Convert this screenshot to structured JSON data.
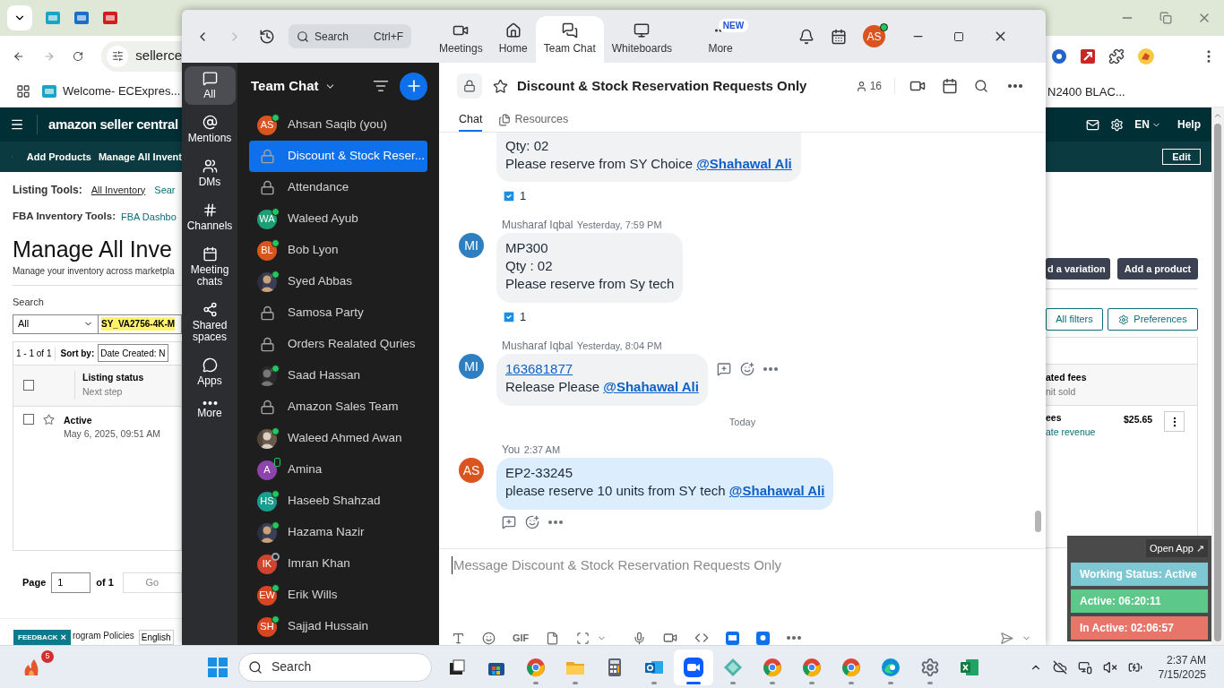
{
  "browser": {
    "address_text": "sellerce",
    "bookmark_left": "Welcome- ECExpres...",
    "bookmark_right": "N2400 BLAC...",
    "logo": "amazon seller central",
    "language": "EN",
    "help": "Help",
    "subnav": [
      "Add Products",
      "Manage All Invent"
    ],
    "edit_button": "Edit",
    "listing_tools": {
      "label": "Listing Tools:",
      "links": [
        "All Inventory",
        "Sear"
      ]
    },
    "fba_tools": {
      "label": "FBA Inventory Tools:",
      "links": [
        "FBA Dashbo"
      ]
    },
    "heading": "Manage All Inve",
    "subheading": "Manage your inventory across marketpla",
    "search_label": "Search",
    "search_scope": "All",
    "search_value": "SY_VA2756-4K-M",
    "result_count": "1 - 1 of 1",
    "sort_label": "Sort by:",
    "sort_value": "Date Created: N",
    "buttons_right": [
      "d a variation",
      "Add a product"
    ],
    "filters_button": "All filters",
    "preferences_button": "Preferences",
    "table": {
      "all_checked": false,
      "columns": [
        {
          "title": "Listing status",
          "subtitle": "Next step"
        },
        {
          "title": "ated fees",
          "subtitle": "nit sold"
        }
      ],
      "rows": [
        {
          "checked": false,
          "starred": false,
          "status": "Active",
          "date": "May 6, 2025, 09:51 AM",
          "fees_label": "ees",
          "fees_link": "ate revenue",
          "fees_value": "$25.65"
        }
      ]
    },
    "pagination": {
      "label": "Page",
      "value": "1",
      "of": "of 1",
      "go": "Go"
    },
    "footer": {
      "feedback": "FEEDBACK",
      "feedback_close": "×",
      "policies": "rogram Policies",
      "language": "English"
    }
  },
  "zoom": {
    "search": {
      "placeholder": "Search",
      "shortcut": "Ctrl+F"
    },
    "tabs": [
      {
        "kind": "meetings",
        "label": "Meetings",
        "selected": false
      },
      {
        "kind": "home",
        "label": "Home",
        "selected": false
      },
      {
        "kind": "chat",
        "label": "Team Chat",
        "selected": true
      },
      {
        "kind": "whiteboard",
        "label": "Whiteboards",
        "selected": false
      },
      {
        "kind": "more",
        "label": "More",
        "selected": false,
        "badge": "NEW"
      }
    ],
    "profile": {
      "initials": "AS",
      "online": true
    },
    "rail": [
      {
        "kind": "all",
        "label": "All",
        "selected": true
      },
      {
        "kind": "mentions",
        "label": "Mentions",
        "selected": false
      },
      {
        "kind": "dms",
        "label": "DMs",
        "selected": false
      },
      {
        "kind": "channels",
        "label": "Channels",
        "selected": false
      },
      {
        "kind": "meeting",
        "label": "Meeting chats",
        "selected": false
      },
      {
        "kind": "shared",
        "label": "Shared spaces",
        "selected": false
      },
      {
        "kind": "apps",
        "label": "Apps",
        "selected": false
      },
      {
        "kind": "more",
        "label": "More",
        "selected": false
      }
    ],
    "list_title": "Team Chat",
    "chats": [
      {
        "kind": "person",
        "name": "Ahsan Saqib (you)",
        "initials": "AS",
        "color": "#d9541e",
        "online": true,
        "mobile": false,
        "selected": false
      },
      {
        "kind": "channel",
        "name": "Discount & Stock Reser...",
        "selected": true
      },
      {
        "kind": "channel",
        "name": "Attendance",
        "selected": false
      },
      {
        "kind": "person",
        "name": "Waleed Ayub",
        "initials": "WA",
        "color": "#1d9e74",
        "online": true,
        "mobile": false,
        "selected": false
      },
      {
        "kind": "person",
        "name": "Bob Lyon",
        "initials": "BL",
        "color": "#d9541e",
        "online": true,
        "mobile": false,
        "selected": false
      },
      {
        "name": "Syed Abbas",
        "online": true,
        "mobile": false,
        "selected": false
      },
      {
        "kind": "channel",
        "name": "Samosa Party",
        "selected": false
      },
      {
        "kind": "channel",
        "name": "Orders Realated Quries",
        "selected": false
      },
      {
        "name": "Saad Hassan",
        "online": true,
        "mobile": false,
        "selected": false
      },
      {
        "kind": "channel",
        "name": "Amazon Sales Team",
        "selected": false
      },
      {
        "name": "Waleed Ahmed Awan",
        "online": true,
        "mobile": false,
        "selected": false
      },
      {
        "kind": "person",
        "name": "Amina",
        "initials": "A",
        "color": "#8e44ad",
        "online": true,
        "mobile": true,
        "selected": false
      },
      {
        "kind": "person",
        "name": "Haseeb Shahzad",
        "initials": "HS",
        "color": "#1a9d8f",
        "online": true,
        "mobile": false,
        "selected": false
      },
      {
        "name": "Hazama Nazir",
        "online": true,
        "mobile": false,
        "selected": false
      },
      {
        "kind": "person",
        "name": "Imran Khan",
        "initials": "IK",
        "color": "#d0432f",
        "online": false,
        "selected": false
      },
      {
        "kind": "person",
        "name": "Erik Wills",
        "initials": "EW",
        "color": "#d9451f",
        "online": true,
        "mobile": false,
        "selected": false
      },
      {
        "kind": "person",
        "name": "Sajjad Hussain",
        "initials": "SH",
        "color": "#d9451f",
        "online": true,
        "mobile": false,
        "selected": false
      }
    ],
    "channel": {
      "title": "Discount & Stock Reservation Requests Only",
      "members": "16",
      "tabs": [
        {
          "kind": "chat",
          "label": "Chat",
          "selected": true
        },
        {
          "kind": "resources",
          "label": "Resources",
          "selected": false
        }
      ]
    },
    "messages": [
      {
        "kind": "message",
        "continued": true,
        "own": false,
        "lines": [
          {
            "text": "Qty: 02"
          },
          {
            "text": "Please reserve from SY Choice",
            "mention": "@Shahawal Ali"
          }
        ],
        "reaction": "1",
        "actions_inline": false,
        "actions_below": false
      },
      {
        "kind": "message",
        "continued": false,
        "own": false,
        "sender": "Musharaf Iqbal",
        "time": "Yesterday, 7:59 PM",
        "initials": "MI",
        "color": "#2e7fc1",
        "lines": [
          {
            "text": "MP300"
          },
          {
            "text": "Qty : 02"
          },
          {
            "text": "Please reserve from Sy tech"
          }
        ],
        "reaction": "1",
        "actions_inline": false,
        "actions_below": false
      },
      {
        "kind": "message",
        "continued": false,
        "own": false,
        "sender": "Musharaf Iqbal",
        "time": "Yesterday, 8:04 PM",
        "initials": "MI",
        "color": "#2e7fc1",
        "lines": [
          {
            "link": "163681877"
          },
          {
            "text": "Release Please",
            "mention": "@Shahawal Ali"
          }
        ],
        "actions_inline": true,
        "actions_below": false
      },
      {
        "kind": "divider",
        "label": "Today"
      },
      {
        "kind": "message",
        "continued": false,
        "own": true,
        "sender": "You",
        "time": "2:37 AM",
        "initials": "AS",
        "color": "#d9541e",
        "lines": [
          {
            "text": "EP2-33245"
          },
          {
            "text": "please reserve 10 units from SY tech",
            "mention": "@Shahawal Ali"
          }
        ],
        "actions_inline": false,
        "actions_below": true
      }
    ],
    "composer": {
      "placeholder": "Message Discount & Stock Reservation Requests Only",
      "gif": "GIF"
    }
  },
  "widget": {
    "open": "Open App ↗",
    "rows": [
      {
        "label": "Working Status: Active",
        "color": "#7ec8d3"
      },
      {
        "label": "Active: 06:20:11",
        "color": "#5cc98a"
      },
      {
        "label": "In Active: 02:06:57",
        "color": "#e8756a"
      }
    ]
  },
  "taskbar": {
    "notification_badge": "5",
    "search_placeholder": "Search",
    "time": "2:37 AM",
    "date": "7/15/2025",
    "apps": [
      {
        "kind": "taskview",
        "running": false,
        "selected": false
      },
      {
        "kind": "store",
        "running": false,
        "selected": false
      },
      {
        "kind": "browser",
        "running": true,
        "selected": false
      },
      {
        "kind": "folder",
        "running": true,
        "selected": false
      },
      {
        "kind": "calculator",
        "running": false,
        "selected": false
      },
      {
        "kind": "mail",
        "running": true,
        "selected": false
      },
      {
        "kind": "video",
        "running": true,
        "selected": true
      },
      {
        "kind": "diamond",
        "running": true,
        "selected": false
      },
      {
        "kind": "browser",
        "running": true,
        "selected": false
      },
      {
        "kind": "browser",
        "running": true,
        "selected": false
      },
      {
        "kind": "browser",
        "running": true,
        "selected": false
      },
      {
        "kind": "edge",
        "running": true,
        "selected": false
      },
      {
        "kind": "settings",
        "running": true,
        "selected": false
      },
      {
        "kind": "spreadsheet",
        "running": false,
        "selected": false
      }
    ]
  }
}
